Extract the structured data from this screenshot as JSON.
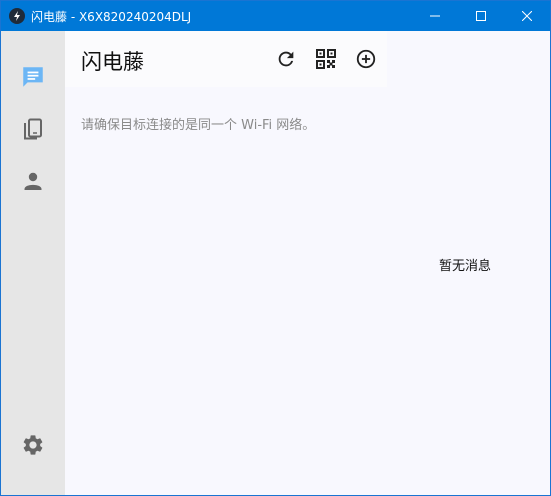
{
  "window": {
    "title": "闪电藤 - X6X820240204DLJ",
    "controls": [
      "minimize",
      "maximize",
      "close"
    ]
  },
  "sidebar": {
    "items": [
      {
        "name": "messages",
        "icon": "chat-icon",
        "active": true
      },
      {
        "name": "devices",
        "icon": "devices-icon",
        "active": false
      },
      {
        "name": "contacts",
        "icon": "person-icon",
        "active": false
      }
    ],
    "footer_icon": "gear-icon"
  },
  "header": {
    "title": "闪电藤",
    "actions": [
      "refresh-icon",
      "qr-code-icon",
      "add-circle-icon"
    ]
  },
  "main": {
    "hint": "请确保目标连接的是同一个 Wi-Fi 网络。",
    "empty_text": "暂无消息"
  },
  "colors": {
    "titlebar": "#0078d7",
    "accent_icon": "#6cb6f5",
    "sidebar_bg": "#e6e6e6",
    "content_bg": "#f8f8fe"
  }
}
